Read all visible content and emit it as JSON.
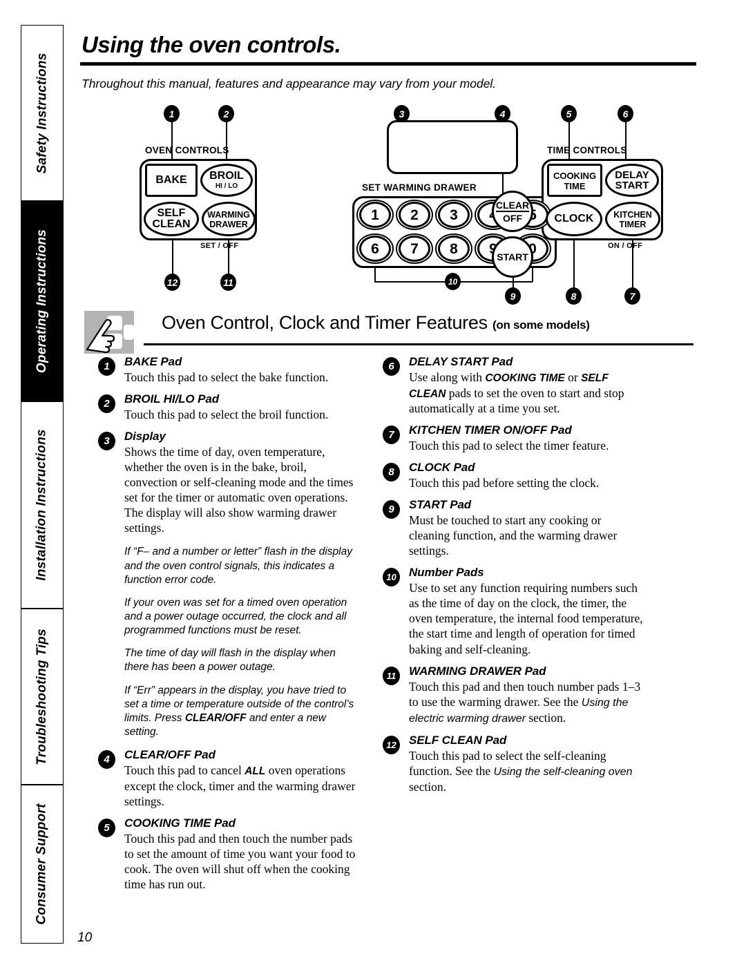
{
  "sidebar": {
    "tabs": [
      {
        "label": "Safety Instructions",
        "active": false
      },
      {
        "label": "Operating Instructions",
        "active": true
      },
      {
        "label": "Installation Instructions",
        "active": false
      },
      {
        "label": "Troubleshooting Tips",
        "active": false
      },
      {
        "label": "Consumer Support",
        "active": false
      }
    ]
  },
  "header": {
    "title": "Using the oven controls.",
    "subtitle": "Throughout this manual, features and appearance may vary from your model."
  },
  "diagram": {
    "oven_controls_label": "OVEN CONTROLS",
    "time_controls_label": "TIME CONTROLS",
    "set_warming_drawer_label": "SET WARMING DRAWER",
    "set_off_label": "SET / OFF",
    "on_off_label": "ON / OFF",
    "pads": {
      "bake": "BAKE",
      "broil": "BROIL",
      "broil_sub": "HI / LO",
      "self_clean_l1": "SELF",
      "self_clean_l2": "CLEAN",
      "warming_l1": "WARMING",
      "warming_l2": "DRAWER",
      "clear_l1": "CLEAR",
      "clear_l2": "OFF",
      "start": "START",
      "cooking_l1": "COOKING",
      "cooking_l2": "TIME",
      "delay_l1": "DELAY",
      "delay_l2": "START",
      "clock": "CLOCK",
      "kitchen_l1": "KITCHEN",
      "kitchen_l2": "TIMER"
    },
    "number_keys": [
      "1",
      "2",
      "3",
      "4",
      "5",
      "6",
      "7",
      "8",
      "9",
      "0"
    ],
    "callouts": [
      "1",
      "2",
      "3",
      "4",
      "5",
      "6",
      "7",
      "8",
      "9",
      "10",
      "11",
      "12"
    ]
  },
  "section": {
    "title": "Oven Control, Clock and Timer Features",
    "title_suffix": "(on some models)"
  },
  "left_column": {
    "entries": [
      {
        "num": "1",
        "heading": "BAKE Pad",
        "body": "Touch this pad to select the bake function."
      },
      {
        "num": "2",
        "heading": "BROIL HI/LO Pad",
        "body": "Touch this pad to select the broil function."
      },
      {
        "num": "3",
        "heading": "Display",
        "body": "Shows the time of day, oven temperature, whether the oven is in the bake, broil, convection or self-cleaning mode and the times set for the timer or automatic oven operations. The display will also show warming drawer settings."
      }
    ],
    "notes": [
      "If “F– and a number or letter” flash in the display and the oven control signals, this indicates a function error code.",
      "If your oven was set for a timed oven operation and a power outage occurred, the clock and all programmed functions must be reset.",
      "The time of day will flash in the display when there has been a power outage."
    ],
    "note_err_a": "If “Err” appears in the display, you have tried to set a time or temperature outside of the control’s limits. Press ",
    "note_err_b": "CLEAR/OFF",
    "note_err_c": " and enter a new setting.",
    "entries_lower": [
      {
        "num": "4",
        "heading": "CLEAR/OFF Pad",
        "body_a": "Touch this pad to cancel ",
        "body_bold": "ALL",
        "body_b": "  oven operations except the clock, timer and the warming drawer settings."
      },
      {
        "num": "5",
        "heading": "COOKING TIME Pad",
        "body": "Touch this pad and then touch the number pads to set the amount of time you want your food to cook. The oven will shut off when the cooking time has run out."
      }
    ]
  },
  "right_column": {
    "entry6": {
      "num": "6",
      "heading": "DELAY START Pad",
      "body_a": "Use along with ",
      "body_bold1": "COOKING TIME",
      "body_mid": " or ",
      "body_bold2": "SELF CLEAN",
      "body_b": " pads to set the oven to start and stop automatically at a time you set."
    },
    "entries": [
      {
        "num": "7",
        "heading": "KITCHEN TIMER ON/OFF Pad",
        "body": "Touch this pad to select the timer feature."
      },
      {
        "num": "8",
        "heading": "CLOCK Pad",
        "body": "Touch this pad before setting the clock."
      },
      {
        "num": "9",
        "heading": "START Pad",
        "body": "Must be touched to start any cooking or cleaning function, and the warming drawer settings."
      },
      {
        "num": "10",
        "heading": "Number Pads",
        "body": "Use to set any function requiring numbers such as the time of day on the clock, the timer, the oven temperature, the internal food temperature, the start time and length of operation for timed baking and self-cleaning."
      }
    ],
    "entry11": {
      "num": "11",
      "heading": "WARMING DRAWER Pad",
      "body_a": "Touch this pad and then touch number pads 1–3 to use the warming drawer. See the ",
      "body_italic": "Using the electric warming drawer",
      "body_b": " section."
    },
    "entry12": {
      "num": "12",
      "heading": "SELF CLEAN Pad",
      "body_a": "Touch this pad to select the self-cleaning function. See the ",
      "body_italic": "Using the self-cleaning oven",
      "body_b": " section."
    }
  },
  "footer": {
    "page_number": "10"
  }
}
